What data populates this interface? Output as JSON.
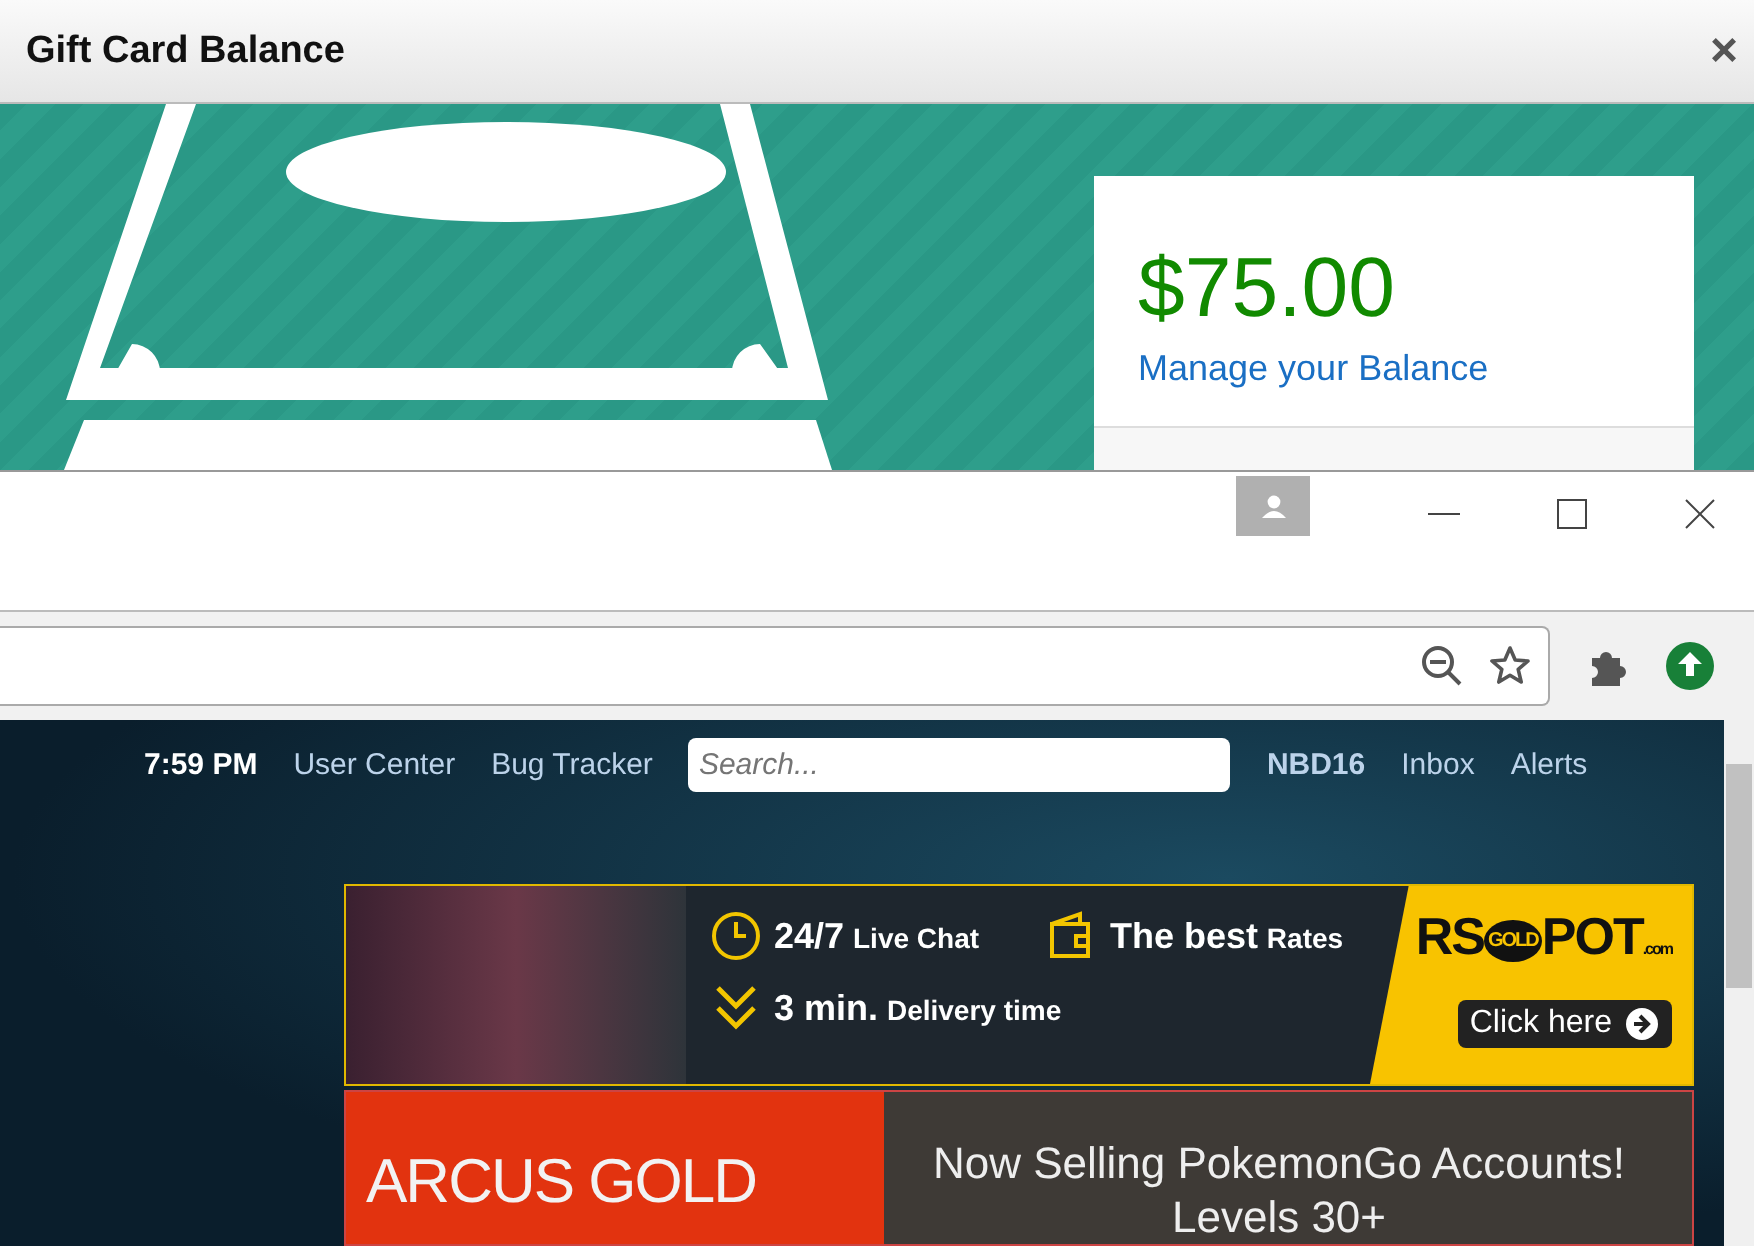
{
  "dialog": {
    "title": "Gift Card Balance",
    "close": "×",
    "balance": "$75.00",
    "manage_link": "Manage your Balance"
  },
  "page": {
    "time": "7:59 PM",
    "nav_links": [
      "User Center",
      "Bug Tracker"
    ],
    "search": {
      "placeholder": "Search..."
    },
    "username": "NBD16",
    "user_links": [
      "Inbox",
      "Alerts"
    ]
  },
  "ads": [
    {
      "kind": "features",
      "features": [
        {
          "big": "24/7",
          "small": "Live Chat",
          "kind": "clock"
        },
        {
          "big": "The best",
          "small": "Rates",
          "kind": "wallet"
        },
        {
          "big": "3 min.",
          "small": "Delivery time",
          "kind": "chevrons"
        }
      ],
      "logo": [
        "RS",
        "GOLD",
        "POT",
        ".com"
      ],
      "button": "Click here"
    },
    {
      "kind": "headline",
      "logo": "ARCUS GOLD",
      "lines": [
        "Now Selling PokemonGo Accounts!",
        "Levels 30+"
      ]
    }
  ]
}
